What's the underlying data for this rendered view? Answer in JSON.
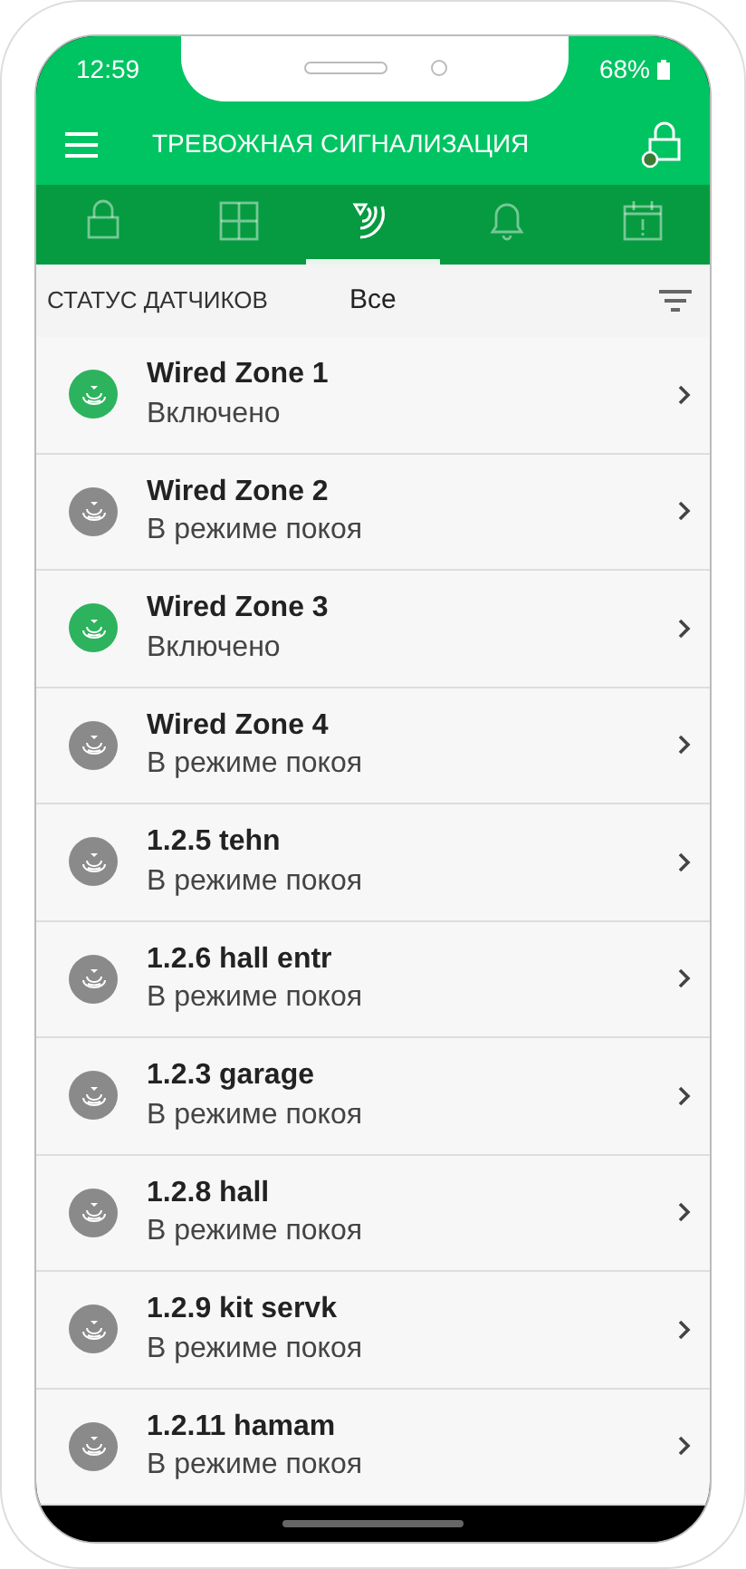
{
  "status_bar": {
    "time": "12:59",
    "battery": "68%"
  },
  "app_bar": {
    "title": "ТРЕВОЖНАЯ СИГНАЛИЗАЦИЯ"
  },
  "tabs": [
    {
      "kind": "lock",
      "selected": false
    },
    {
      "kind": "grid",
      "selected": false
    },
    {
      "kind": "sensors",
      "selected": true
    },
    {
      "kind": "bell",
      "selected": false
    },
    {
      "kind": "calendar",
      "selected": false
    }
  ],
  "filter_row": {
    "label": "СТАТУС ДАТЧИКОВ",
    "filter": "Все"
  },
  "sensors": [
    {
      "name": "Wired Zone 1",
      "status": "Включено",
      "active": true
    },
    {
      "name": "Wired Zone 2",
      "status": "В режиме покоя",
      "active": false
    },
    {
      "name": "Wired Zone 3",
      "status": "Включено",
      "active": true
    },
    {
      "name": "Wired Zone 4",
      "status": "В режиме покоя",
      "active": false
    },
    {
      "name": "1.2.5 tehn",
      "status": "В режиме покоя",
      "active": false
    },
    {
      "name": "1.2.6 hall entr",
      "status": "В режиме покоя",
      "active": false
    },
    {
      "name": "1.2.3 garage",
      "status": "В режиме покоя",
      "active": false
    },
    {
      "name": "1.2.8 hall",
      "status": "В режиме покоя",
      "active": false
    },
    {
      "name": "1.2.9 kit servk",
      "status": "В режиме покоя",
      "active": false
    },
    {
      "name": "1.2.11 hamam",
      "status": "В режиме покоя",
      "active": false
    }
  ]
}
